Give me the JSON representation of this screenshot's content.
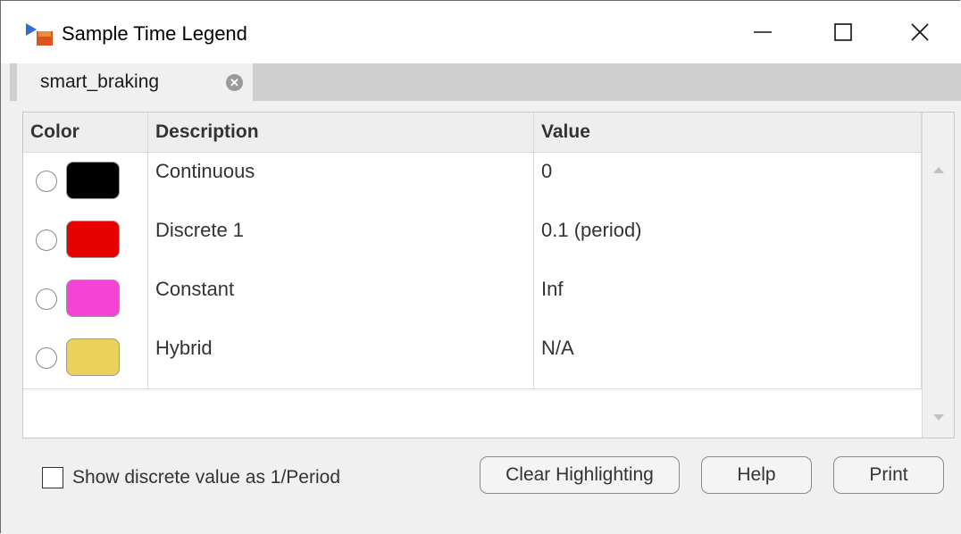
{
  "window": {
    "title": "Sample Time Legend",
    "controls": {
      "minimize": "minimize-icon",
      "maximize": "maximize-icon",
      "close": "close-icon"
    }
  },
  "tabs": [
    {
      "label": "smart_braking",
      "active": true
    }
  ],
  "table": {
    "headers": {
      "color": "Color",
      "description": "Description",
      "value": "Value"
    },
    "rows": [
      {
        "color": "#000000",
        "description": "Continuous",
        "value": "0"
      },
      {
        "color": "#e60000",
        "description": "Discrete 1",
        "value": "0.1 (period)"
      },
      {
        "color": "#f542d7",
        "description": "Constant",
        "value": "Inf"
      },
      {
        "color": "#ead15a",
        "description": "Hybrid",
        "value": "N/A"
      }
    ]
  },
  "options": {
    "show_discrete_label": "Show discrete value as 1/Period",
    "show_discrete_checked": false
  },
  "buttons": {
    "clear_highlighting": "Clear Highlighting",
    "help": "Help",
    "print": "Print"
  }
}
